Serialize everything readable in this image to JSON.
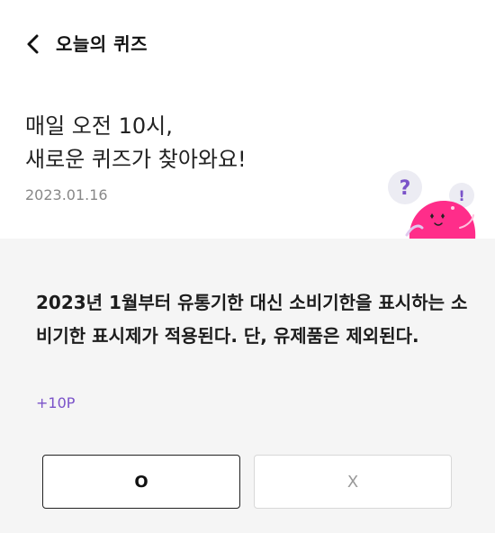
{
  "header": {
    "title": "오늘의 퀴즈"
  },
  "intro": {
    "line1": "매일 오전 10시,",
    "line2": "새로운 퀴즈가 찾아와요!",
    "date": "2023.01.16"
  },
  "quiz": {
    "question": "2023년 1월부터 유통기한 대신 소비기한을 표시하는 소비기한 표시제가 적용된다. 단, 유제품은 제외된다.",
    "points": "+10P",
    "answer_o": "O",
    "answer_x": "X"
  },
  "mascot": {
    "question_mark": "?",
    "exclaim_mark": "!"
  },
  "colors": {
    "accent_purple": "#7a52c9",
    "mascot_pink": "#ff2d8a",
    "quiz_bg": "#f5f5f5"
  },
  "icons": {
    "back": "chevron-left-icon"
  }
}
